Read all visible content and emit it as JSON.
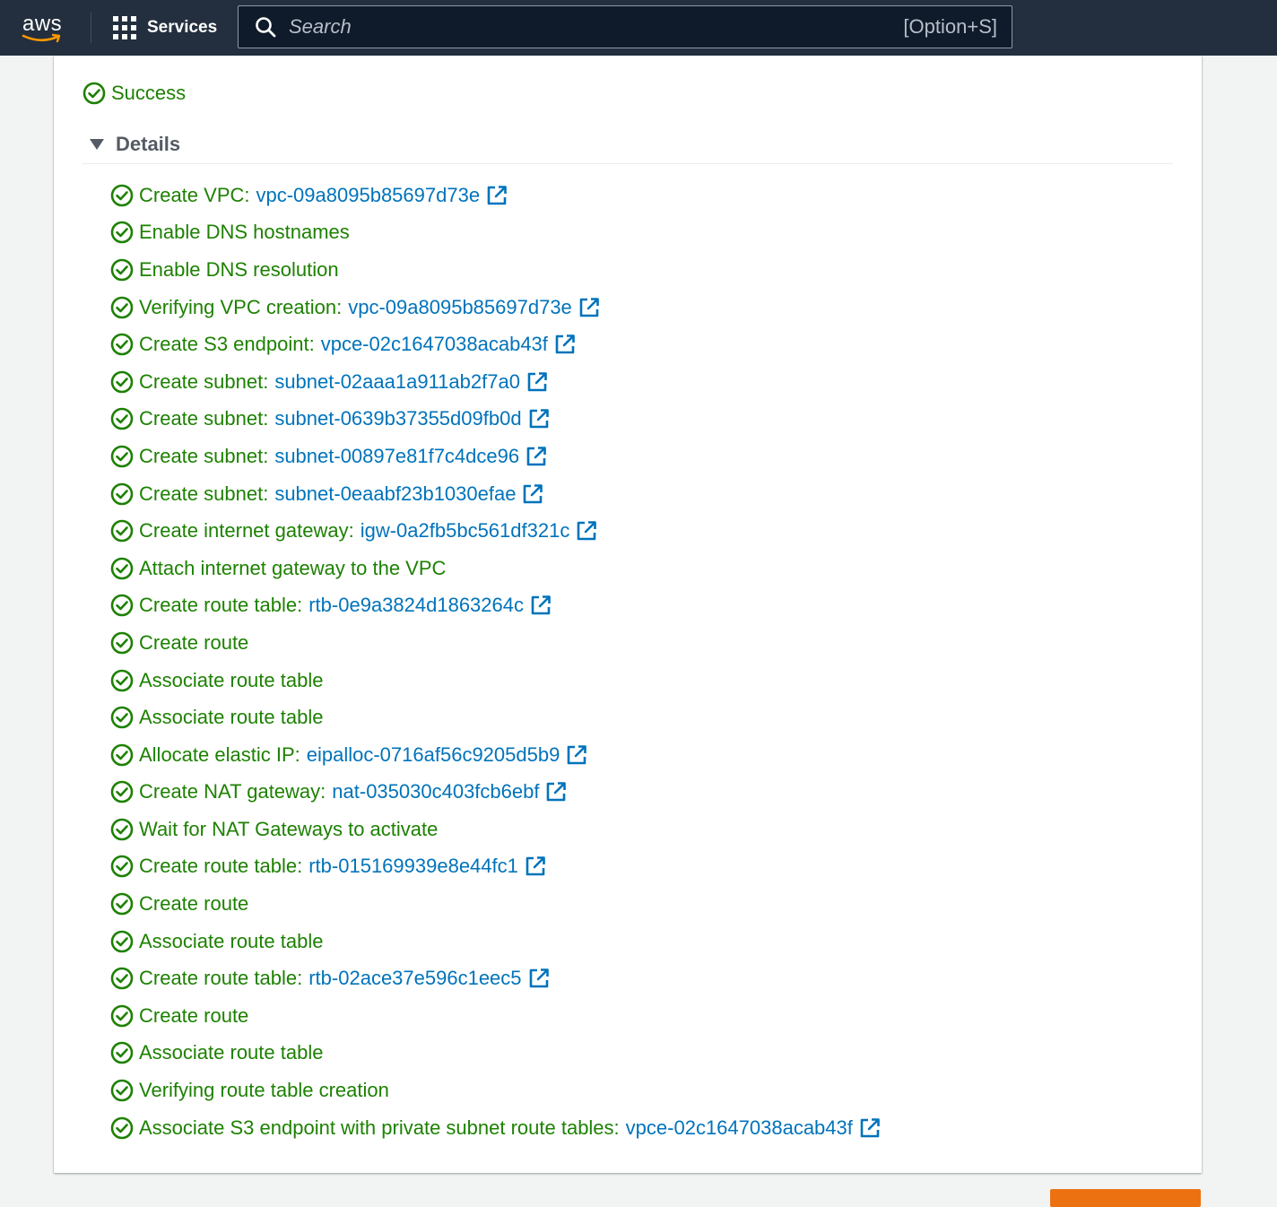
{
  "nav": {
    "logo": "aws",
    "services_label": "Services",
    "search_placeholder": "Search",
    "search_shortcut": "[Option+S]"
  },
  "status": {
    "label": "Success",
    "color": "#1d8102"
  },
  "details": {
    "title": "Details",
    "steps": [
      {
        "label": "Create VPC:",
        "resource": "vpc-09a8095b85697d73e"
      },
      {
        "label": "Enable DNS hostnames",
        "resource": null
      },
      {
        "label": "Enable DNS resolution",
        "resource": null
      },
      {
        "label": "Verifying VPC creation:",
        "resource": "vpc-09a8095b85697d73e"
      },
      {
        "label": "Create S3 endpoint:",
        "resource": "vpce-02c1647038acab43f"
      },
      {
        "label": "Create subnet:",
        "resource": "subnet-02aaa1a911ab2f7a0"
      },
      {
        "label": "Create subnet:",
        "resource": "subnet-0639b37355d09fb0d"
      },
      {
        "label": "Create subnet:",
        "resource": "subnet-00897e81f7c4dce96"
      },
      {
        "label": "Create subnet:",
        "resource": "subnet-0eaabf23b1030efae"
      },
      {
        "label": "Create internet gateway:",
        "resource": "igw-0a2fb5bc561df321c"
      },
      {
        "label": "Attach internet gateway to the VPC",
        "resource": null
      },
      {
        "label": "Create route table:",
        "resource": "rtb-0e9a3824d1863264c"
      },
      {
        "label": "Create route",
        "resource": null
      },
      {
        "label": "Associate route table",
        "resource": null
      },
      {
        "label": "Associate route table",
        "resource": null
      },
      {
        "label": "Allocate elastic IP:",
        "resource": "eipalloc-0716af56c9205d5b9"
      },
      {
        "label": "Create NAT gateway:",
        "resource": "nat-035030c403fcb6ebf"
      },
      {
        "label": "Wait for NAT Gateways to activate",
        "resource": null
      },
      {
        "label": "Create route table:",
        "resource": "rtb-015169939e8e44fc1"
      },
      {
        "label": "Create route",
        "resource": null
      },
      {
        "label": "Associate route table",
        "resource": null
      },
      {
        "label": "Create route table:",
        "resource": "rtb-02ace37e596c1eec5"
      },
      {
        "label": "Create route",
        "resource": null
      },
      {
        "label": "Associate route table",
        "resource": null
      },
      {
        "label": "Verifying route table creation",
        "resource": null
      },
      {
        "label": "Associate S3 endpoint with private subnet route tables:",
        "resource": "vpce-02c1647038acab43f"
      }
    ]
  },
  "colors": {
    "nav_bg": "#232f3e",
    "success": "#1d8102",
    "link": "#0073bb",
    "primary_button": "#ec7211"
  }
}
